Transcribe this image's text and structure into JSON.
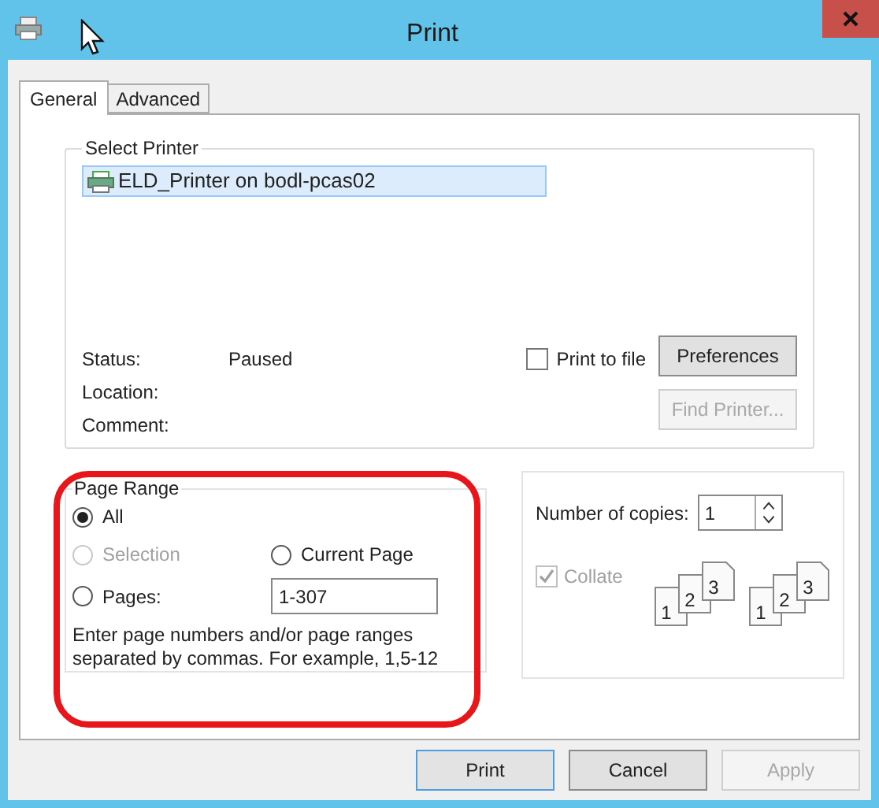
{
  "window": {
    "title": "Print"
  },
  "tabs": [
    {
      "label": "General",
      "selected": true
    },
    {
      "label": "Advanced",
      "selected": false
    }
  ],
  "select_printer": {
    "legend": "Select Printer",
    "printers": [
      {
        "name": "ELD_Printer on bodl-pcas02",
        "selected": true
      }
    ],
    "info": [
      {
        "label": "Status:",
        "value": "Paused"
      },
      {
        "label": "Location:"
      },
      {
        "label": "Comment:"
      }
    ],
    "print_to_file": {
      "label": "Print to file",
      "checked": false
    },
    "buttons": [
      {
        "label": "Preferences",
        "disabled": false
      },
      {
        "label": "Find Printer...",
        "disabled": true
      }
    ]
  },
  "page_range": {
    "legend": "Page Range",
    "options": [
      {
        "label": "All",
        "selected": true,
        "disabled": false
      },
      {
        "label": "Selection",
        "selected": false,
        "disabled": true
      },
      {
        "label": "Current Page",
        "selected": false,
        "disabled": false
      },
      {
        "label": "Pages:",
        "selected": false,
        "disabled": false
      }
    ],
    "pages_value": "1-307",
    "hint": "Enter page numbers and/or page ranges separated by commas.  For example, 1,5-12",
    "highlighted": true
  },
  "copies": {
    "label": "Number of copies:",
    "value": "1",
    "collate": {
      "label": "Collate",
      "checked": true,
      "disabled": true
    },
    "collate_icons": [
      {
        "pages": [
          "1",
          "2",
          "3"
        ]
      },
      {
        "pages": [
          "1",
          "2",
          "3"
        ]
      }
    ]
  },
  "buttons": [
    {
      "label": "Print",
      "disabled": false,
      "default": true
    },
    {
      "label": "Cancel",
      "disabled": false,
      "default": false
    },
    {
      "label": "Apply",
      "disabled": true,
      "default": false
    }
  ]
}
